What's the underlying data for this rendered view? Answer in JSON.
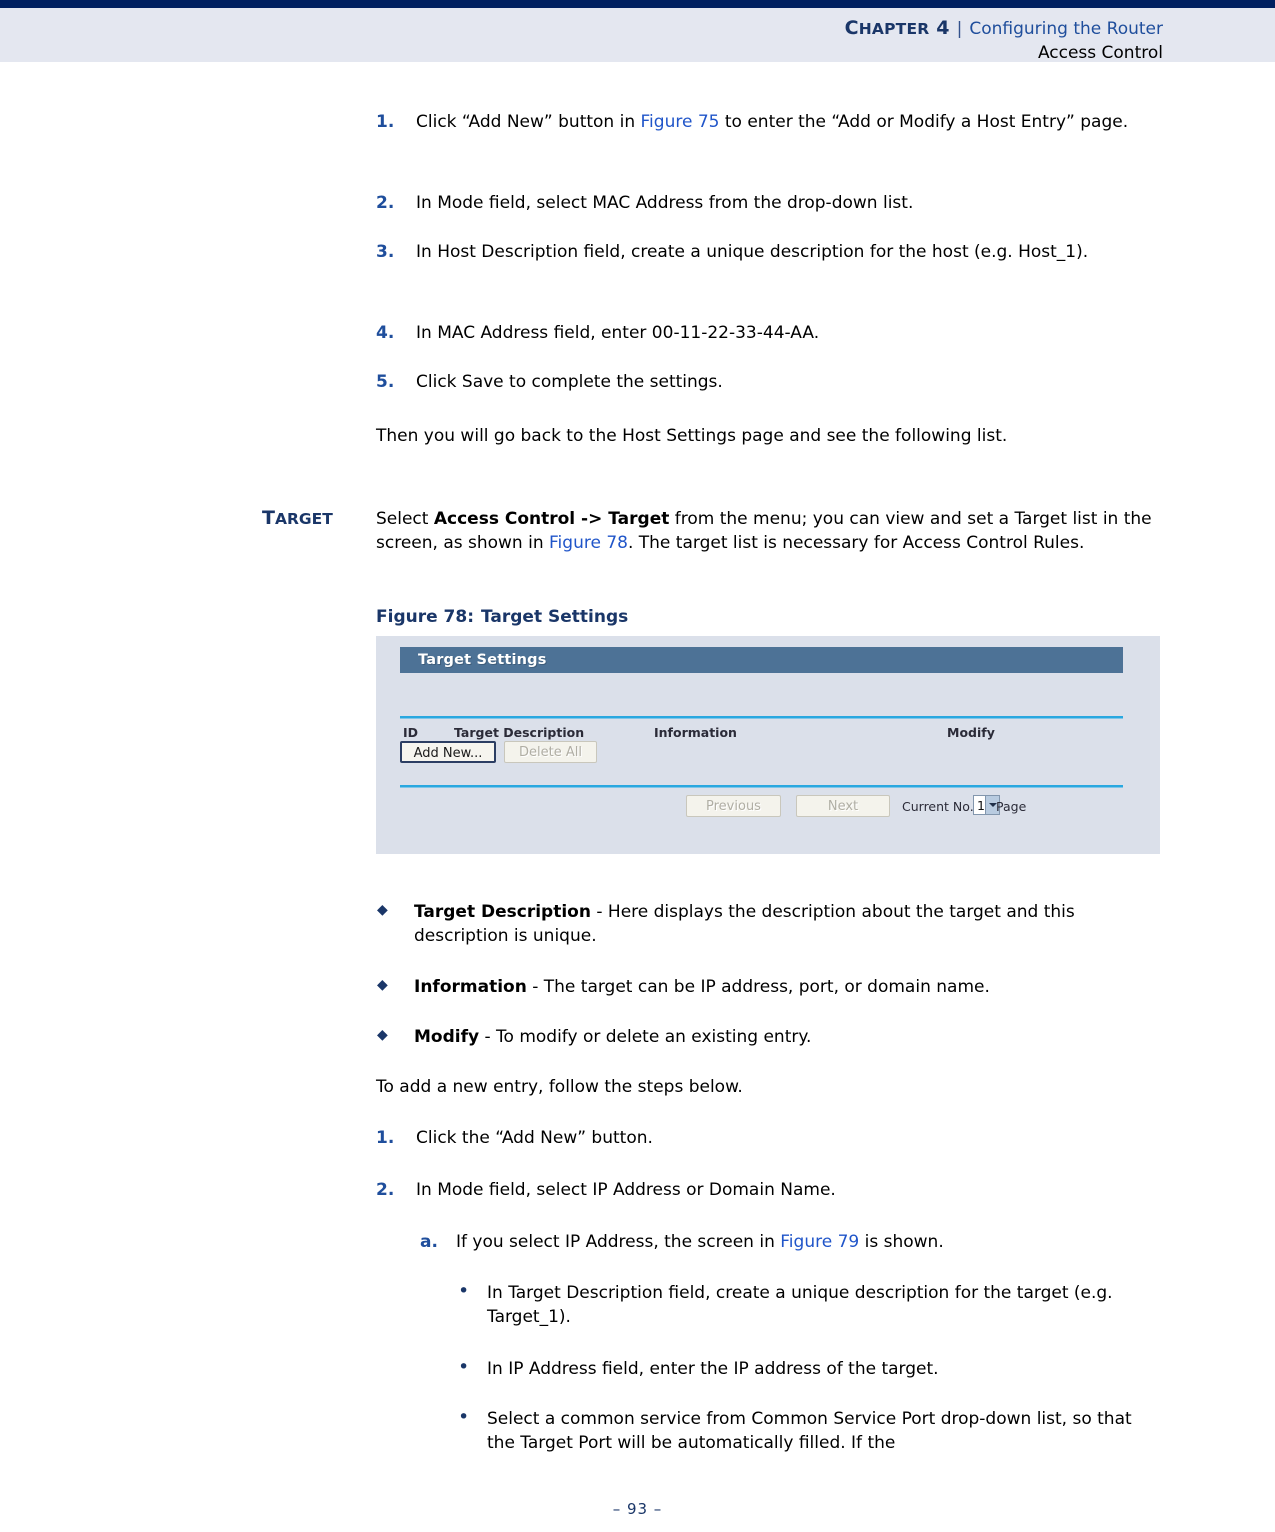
{
  "header": {
    "chapter_prefix": "C",
    "chapter_rest": "HAPTER",
    "chapter_number": "4",
    "separator": "|",
    "chapter_title": "Configuring the Router",
    "section_title": "Access Control"
  },
  "steps_first": [
    {
      "num": "1.",
      "pre": "Click “Add New” button in ",
      "link": "Figure 75",
      "post": " to enter the “Add or Modify a Host Entry” page."
    },
    {
      "num": "2.",
      "pre": "In Mode field, select MAC Address from the drop-down list.",
      "link": "",
      "post": ""
    },
    {
      "num": "3.",
      "pre": "In Host Description field, create a unique description for the host (e.g. Host_1).",
      "link": "",
      "post": ""
    },
    {
      "num": "4.",
      "pre": "In MAC Address field, enter 00-11-22-33-44-AA.",
      "link": "",
      "post": ""
    },
    {
      "num": "5.",
      "pre": "Click Save to complete the settings.",
      "link": "",
      "post": ""
    }
  ],
  "then_paragraph": "Then you will go back to the Host Settings page and see the following list.",
  "target_section": {
    "margin_head_cap": "T",
    "margin_head_rest": "ARGET",
    "intro_pre": "Select ",
    "intro_bold": "Access Control -> Target",
    "intro_mid": " from the menu; you can view and set a Target list in the screen, as shown in ",
    "intro_link": "Figure 78",
    "intro_post": ". The target list is necessary for Access Control Rules."
  },
  "figure": {
    "caption_label": "Figure 78:",
    "caption_title": "Target Settings",
    "panel_title": "Target Settings",
    "columns": [
      "ID",
      "Target Description",
      "Information",
      "Modify"
    ],
    "rows": [],
    "buttons": {
      "add_new": "Add New...",
      "delete_all": "Delete All",
      "previous": "Previous",
      "next": "Next"
    },
    "pager": {
      "current_label": "Current No.",
      "current_value": "1",
      "page_label": "Page"
    },
    "colors": {
      "panel_background": "#dbe0ea",
      "title_bar": "#4d7296",
      "divider": "#29a8e0",
      "button_face": "#f4f3ec",
      "active_border": "#2c3e63"
    }
  },
  "field_bullets": [
    {
      "term": "Target Description",
      "text": " - Here displays the description about the target and this description is unique."
    },
    {
      "term": "Information",
      "text": " - The target can be IP address, port, or domain name."
    },
    {
      "term": "Modify",
      "text": " - To modify or delete an existing entry."
    }
  ],
  "add_entry_intro": "To add a new entry, follow the steps below.",
  "steps_second": [
    {
      "num": "1.",
      "text": "Click the “Add New” button."
    },
    {
      "num": "2.",
      "text": "In Mode field, select IP Address or Domain Name."
    }
  ],
  "substep_a": {
    "num": "a.",
    "pre": "If you select IP Address, the screen in ",
    "link": "Figure 79",
    "post": " is shown."
  },
  "inner_bullets": [
    "In Target Description field, create a unique description for the target (e.g. Target_1).",
    "In IP Address field, enter the IP address of the target.",
    "Select a common service from Common Service Port drop-down list, so that the Target Port will be automatically filled. If the"
  ],
  "footer": {
    "page_number": "–  93  –"
  },
  "icons": {
    "diamond_bullet": "◆",
    "round_bullet": "•",
    "select_arrow": "chevron-down-icon"
  }
}
